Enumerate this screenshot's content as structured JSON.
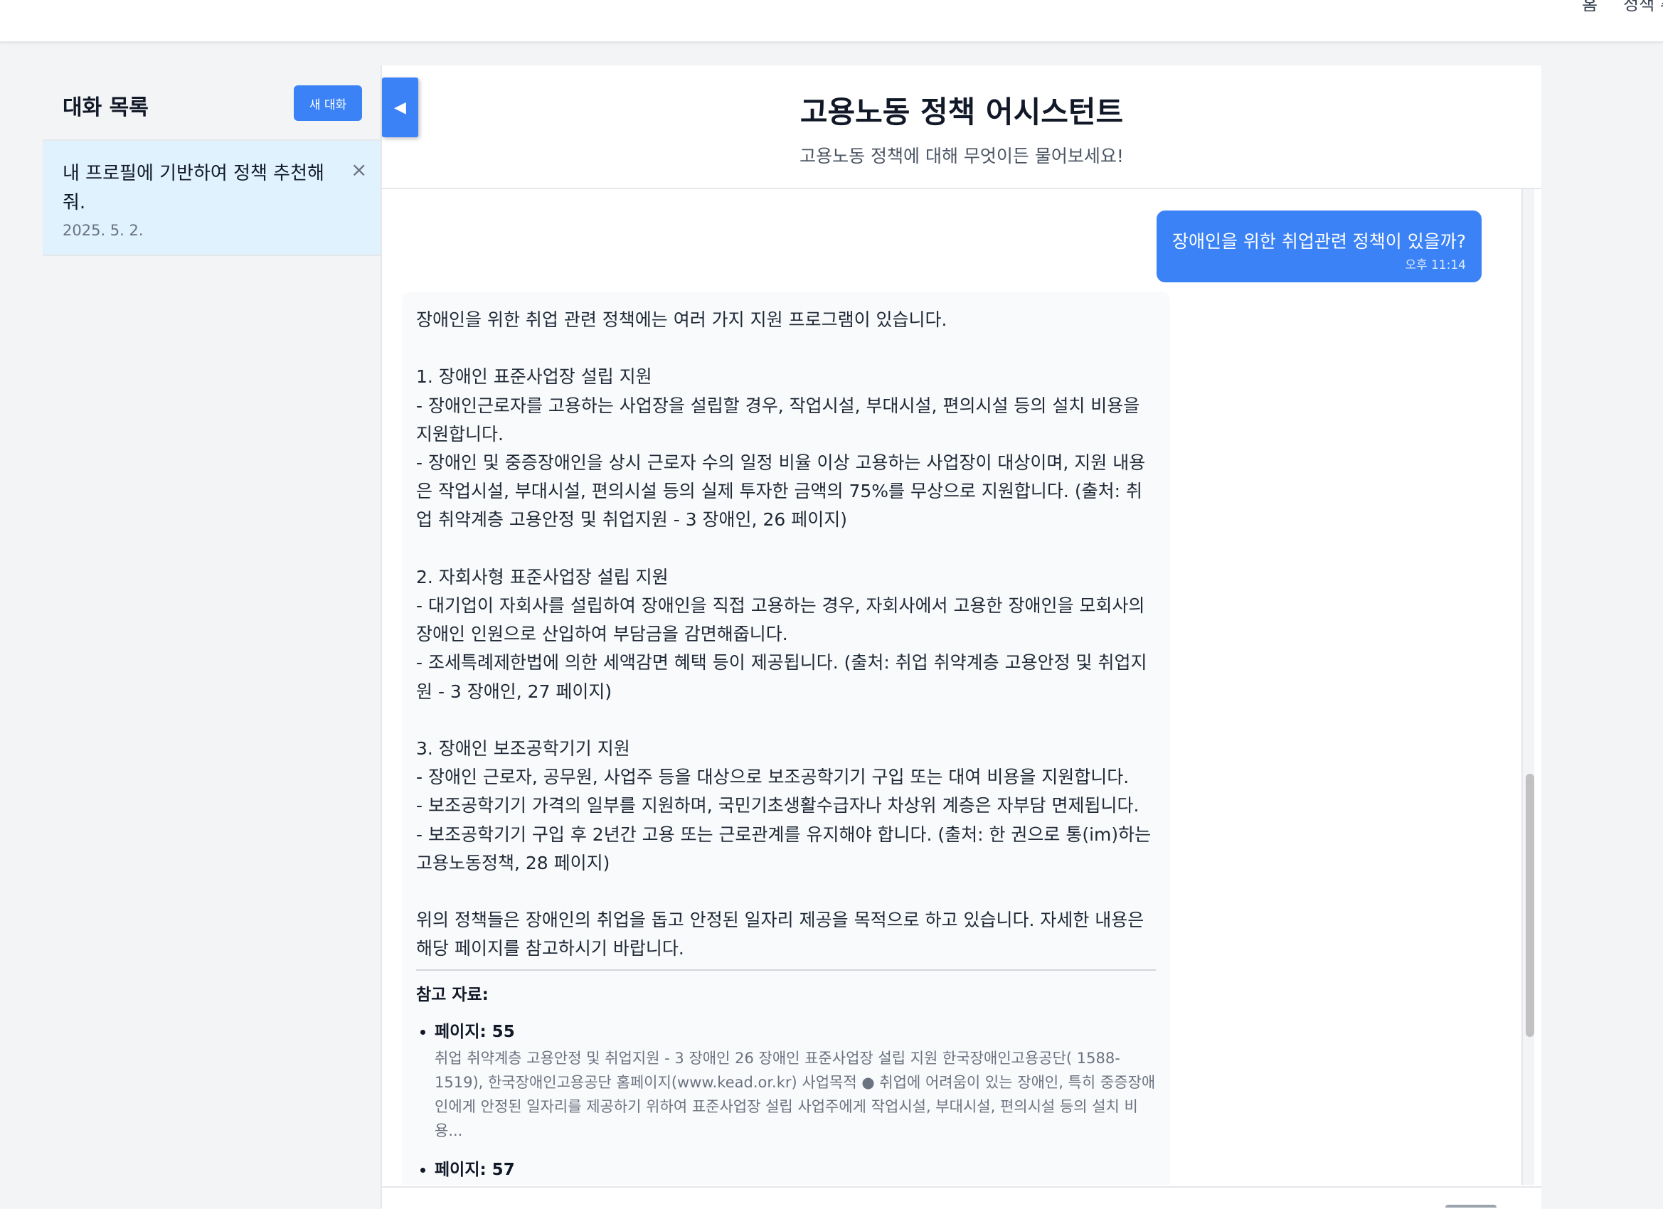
{
  "nav": {
    "links": [
      "홈",
      "정책 추천"
    ]
  },
  "sidebar": {
    "title": "대화 목록",
    "new_chat_label": "새 대화",
    "conversations": [
      {
        "title": "내 프로필에 기반하여 정책 추천해줘.",
        "date": "2025. 5. 2.",
        "close": "×"
      }
    ]
  },
  "toggle": {
    "icon": "◀"
  },
  "main": {
    "title": "고용노동 정책 어시스턴트",
    "subtitle": "고용노동 정책에 대해 무엇이든 물어보세요!"
  },
  "messages": {
    "user": {
      "text": "장애인을 위한 취업관련 정책이 있을까?",
      "time": "오후 11:14"
    },
    "bot": {
      "text": "장애인을 위한 취업 관련 정책에는 여러 가지 지원 프로그램이 있습니다.\n\n1. 장애인 표준사업장 설립 지원\n- 장애인근로자를 고용하는 사업장을 설립할 경우, 작업시설, 부대시설, 편의시설 등의 설치 비용을 지원합니다.\n- 장애인 및 중증장애인을 상시 근로자 수의 일정 비율 이상 고용하는 사업장이 대상이며, 지원 내용은 작업시설, 부대시설, 편의시설 등의 실제 투자한 금액의 75%를 무상으로 지원합니다. (출처: 취업 취약계층 고용안정 및 취업지원 - 3 장애인, 26 페이지)\n\n2. 자회사형 표준사업장 설립 지원\n- 대기업이 자회사를 설립하여 장애인을 직접 고용하는 경우, 자회사에서 고용한 장애인을 모회사의 장애인 인원으로 산입하여 부담금을 감면해줍니다.\n- 조세특례제한법에 의한 세액감면 혜택 등이 제공됩니다. (출처: 취업 취약계층 고용안정 및 취업지원 - 3 장애인, 27 페이지)\n\n3. 장애인 보조공학기기 지원\n- 장애인 근로자, 공무원, 사업주 등을 대상으로 보조공학기기 구입 또는 대여 비용을 지원합니다.\n- 보조공학기기 가격의 일부를 지원하며, 국민기초생활수급자나 차상위 계층은 자부담 면제됩니다.\n- 보조공학기기 구입 후 2년간 고용 또는 근로관계를 유지해야 합니다. (출처: 한 권으로 통(im)하는 고용노동정책, 28 페이지)\n\n위의 정책들은 장애인의 취업을 돕고 안정된 일자리 제공을 목적으로 하고 있습니다. 자세한 내용은 해당 페이지를 참고하시기 바랍니다.",
      "refs_title": "참고 자료:",
      "refs": [
        {
          "page": "페이지: 55",
          "text": "취업 취약계층 고용안정 및 취업지원 - 3 장애인 26 장애인 표준사업장 설립 지원 한국장애인고용공단( 1588-1519), 한국장애인고용공단 홈페이지(www.kead.or.kr) 사업목적 ● 취업에 어려움이 있는 장애인, 특히 중증장애인에게 안정된 일자리를 제공하기 위하여 표준사업장 설립 사업주에게 작업시설, 부대시설, 편의시설 등의 설치 비용..."
        },
        {
          "page": "페이지: 57",
          "text": ""
        }
      ]
    }
  },
  "colors": {
    "accent": "#3b82f6",
    "selected_conv": "#e0f2fe"
  }
}
